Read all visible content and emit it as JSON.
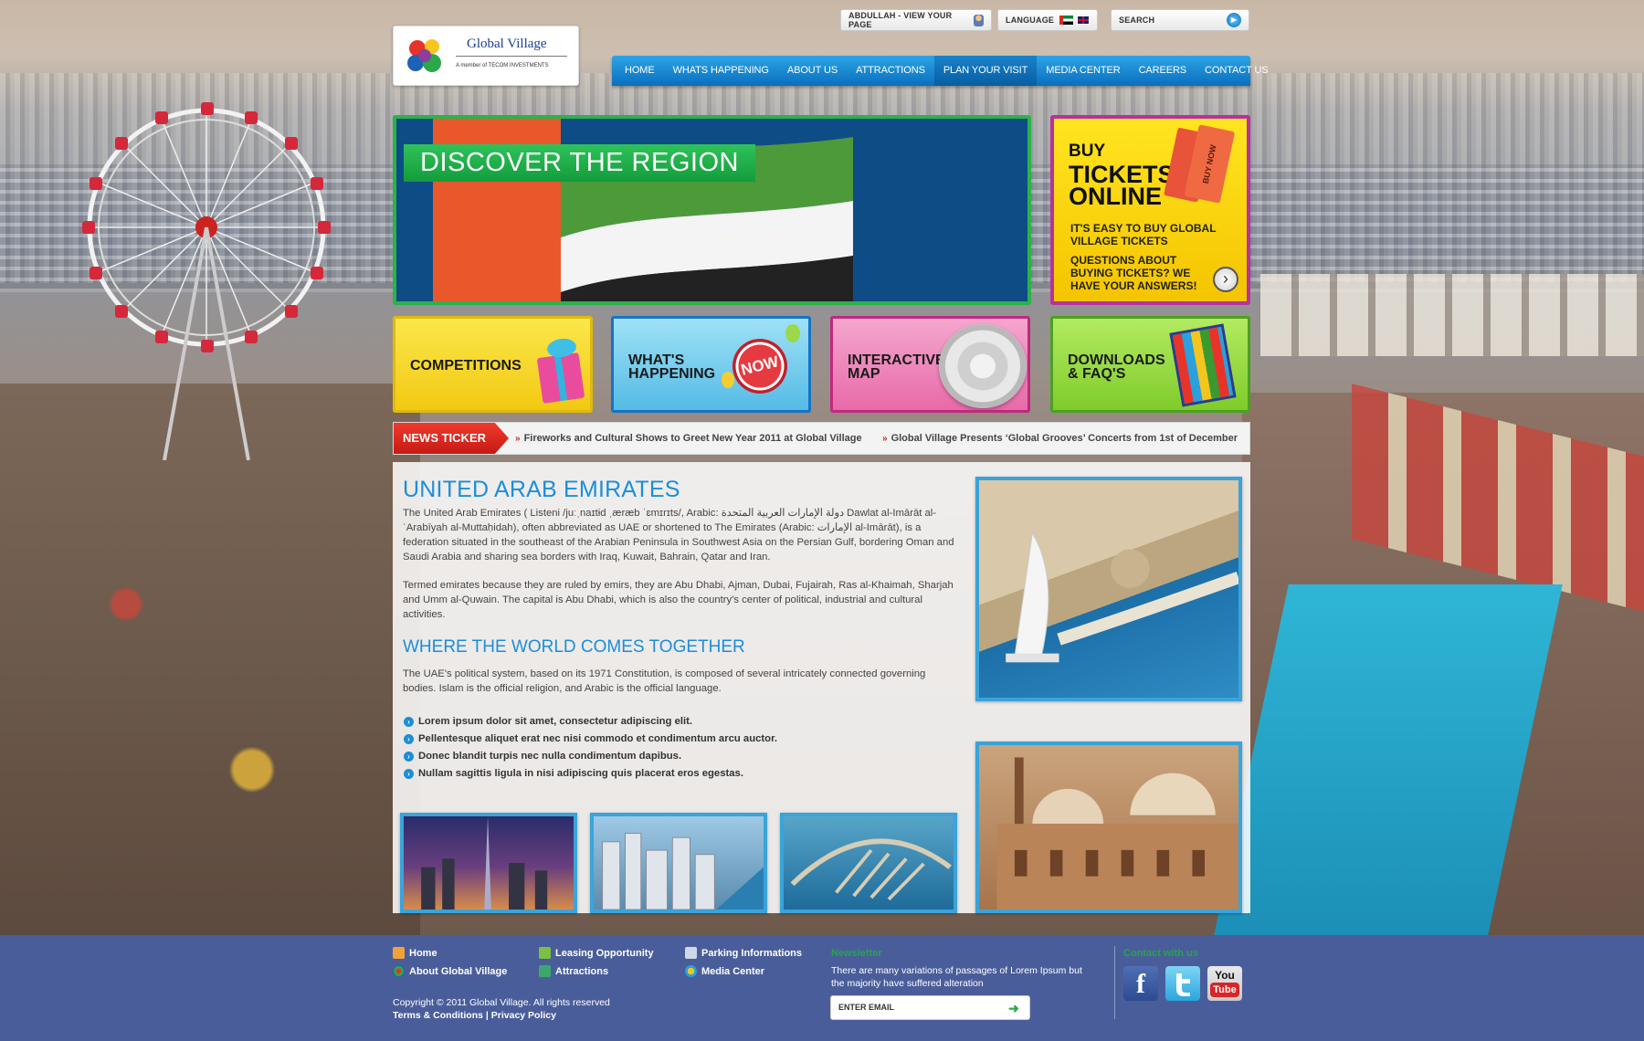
{
  "header": {
    "logo_title": "Global Village",
    "logo_subtitle": "A member of TECOM INVESTMENTS",
    "user_link": "ABDULLAH - VIEW YOUR PAGE",
    "language_label": "LANGUAGE",
    "search_placeholder": "SEARCH"
  },
  "nav": {
    "items": [
      {
        "label": "HOME"
      },
      {
        "label": "WHATS HAPPENING"
      },
      {
        "label": "ABOUT US"
      },
      {
        "label": "ATTRACTIONS"
      },
      {
        "label": "PLAN YOUR VISIT"
      },
      {
        "label": "MEDIA CENTER"
      },
      {
        "label": "CAREERS"
      },
      {
        "label": "CONTACT US"
      }
    ],
    "active_index": 4
  },
  "hero": {
    "title": "DISCOVER THE REGION"
  },
  "tickets": {
    "line1": "BUY",
    "line2": "TICKETS",
    "line3": "ONLINE",
    "stub_text": "BUY NOW",
    "text1": "IT'S EASY TO BUY GLOBAL VILLAGE TICKETS",
    "text2": "QUESTIONS ABOUT BUYING TICKETS? WE HAVE YOUR ANSWERS!"
  },
  "tiles": [
    {
      "line1": "COMPETITIONS",
      "line2": ""
    },
    {
      "line1": "WHAT'S",
      "line2": "HAPPENING",
      "badge": "NOW"
    },
    {
      "line1": "INTERACTIVE",
      "line2": "MAP"
    },
    {
      "line1": "DOWNLOADS",
      "line2": "& FAQ'S"
    }
  ],
  "ticker": {
    "label": "NEWS TICKER",
    "items": [
      "Fireworks and Cultural Shows to Greet New Year 2011 at Global Village",
      "Global Village Presents ‘Global Grooves’ Concerts from 1st of December"
    ]
  },
  "content": {
    "heading1": "UNITED ARAB EMIRATES",
    "para1": "The United Arab Emirates ( Listeni /juːˌnaɪtɨd ˌæræb ˈɛmɪrɪts/, Arabic: دولة الإمارات العربية المتحدة‎ Dawlat al-Imārāt al-ʿArabīyah al-Muttaḥidah), often abbreviated as UAE or shortened to The Emirates (Arabic: الإمارات‎ al-Imārāt), is a federation situated in the southeast of the Arabian Peninsula in Southwest Asia on the Persian Gulf, bordering Oman and Saudi Arabia and sharing sea borders with Iraq, Kuwait, Bahrain, Qatar and Iran.",
    "para2": "Termed emirates because they are ruled by emirs, they are Abu Dhabi, Ajman, Dubai, Fujairah, Ras al-Khaimah, Sharjah and Umm al-Quwain. The capital is Abu Dhabi, which is also the country's center of political, industrial and cultural activities.",
    "heading2": "WHERE THE WORLD COMES TOGETHER",
    "para3": "The UAE's political system, based on its 1971 Constitution, is composed of several intricately connected governing bodies. Islam is the official religion, and Arabic is the official language.",
    "bullets": [
      "Lorem ipsum dolor sit amet, consectetur adipiscing elit.",
      "Pellentesque aliquet erat nec nisi commodo et condimentum arcu auctor.",
      "Donec blandit turpis nec nulla condimentum dapibus.",
      "Nullam sagittis ligula in nisi adipiscing quis placerat eros egestas."
    ]
  },
  "footer": {
    "links": [
      {
        "label": "Home",
        "icon": "home-icon"
      },
      {
        "label": "About Global Village",
        "icon": "globe-icon"
      },
      {
        "label": "Leasing Opportunity",
        "icon": "leasing-icon"
      },
      {
        "label": "Attractions",
        "icon": "attractions-icon"
      },
      {
        "label": "Parking Informations",
        "icon": "car-icon"
      },
      {
        "label": "Media Center",
        "icon": "media-icon"
      }
    ],
    "copyright": "Copyright © 2011 Global Village. All rights reserved",
    "terms": "Terms & Conditions",
    "privacy": "Privacy Policy",
    "newsletter_title": "Newsletter",
    "newsletter_text": "There are many variations of passages of Lorem Ipsum but the majority have suffered alteration",
    "email_placeholder": "ENTER EMAIL",
    "contact_title": "Contact with us",
    "social": {
      "facebook": "f",
      "youtube_1": "You",
      "youtube_2": "Tube"
    }
  }
}
